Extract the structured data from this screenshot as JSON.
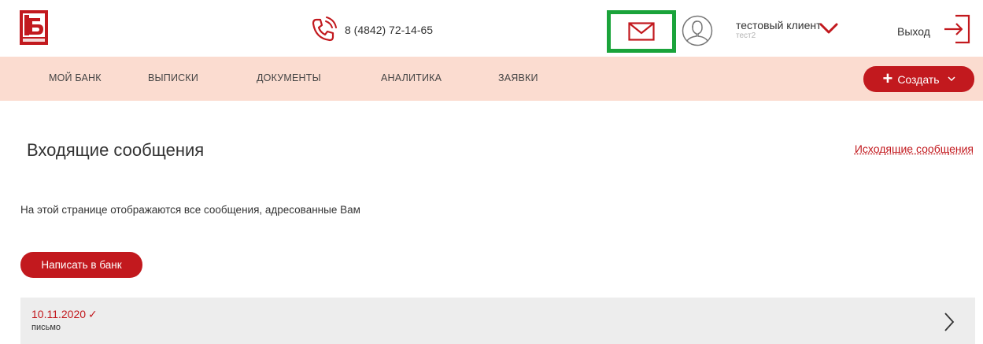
{
  "header": {
    "phone": "8 (4842) 72-14-65",
    "user_name": "тестовый клиент",
    "user_sub": "тест2",
    "logout_label": "Выход"
  },
  "nav": {
    "items": [
      {
        "label": "МОЙ БАНК"
      },
      {
        "label": "ВЫПИСКИ"
      },
      {
        "label": "ДОКУМЕНТЫ"
      },
      {
        "label": "АНАЛИТИКА"
      },
      {
        "label": "ЗАЯВКИ"
      }
    ],
    "create_label": "Создать"
  },
  "main": {
    "title": "Входящие сообщения",
    "outgoing_link": "Исходящие сообщения",
    "description": "На этой странице отображаются все сообщения, адресованные Вам",
    "write_button": "Написать в банк",
    "messages": [
      {
        "date": "10.11.2020",
        "check": "✓",
        "subject": "письмо"
      }
    ]
  },
  "colors": {
    "accent": "#c2191e",
    "nav_bg": "#fbdcd0",
    "highlight": "#1aa33a",
    "row_bg": "#ededed"
  },
  "icons": {
    "logo": "bank-logo-icon",
    "phone": "phone-icon",
    "mail": "mail-icon",
    "avatar": "user-avatar-icon",
    "user_menu": "chevron-down-icon",
    "logout": "logout-icon",
    "create": "plus-icon",
    "row_open": "chevron-right-icon"
  }
}
